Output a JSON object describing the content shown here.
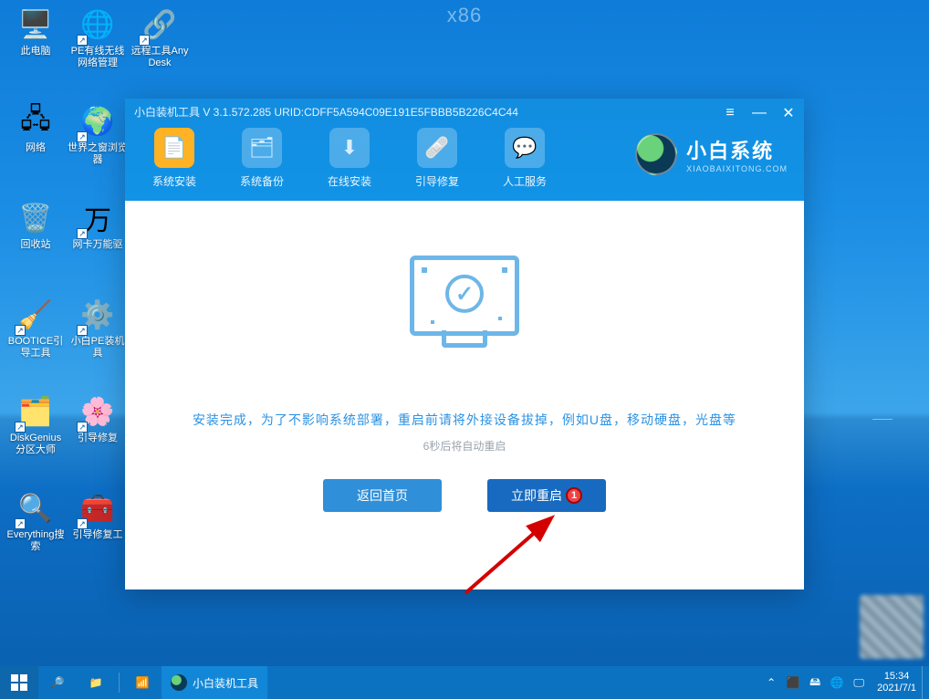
{
  "x86_label": "x86",
  "desktop_icons": [
    {
      "id": "this-pc",
      "label": "此电脑",
      "glyph": "🖥️",
      "shortcut": false
    },
    {
      "id": "pe-net",
      "label": "PE有线无线网络管理",
      "glyph": "🌐",
      "shortcut": true
    },
    {
      "id": "anydesk",
      "label": "远程工具AnyDesk",
      "glyph": "🔗",
      "shortcut": true
    },
    {
      "id": "network",
      "label": "网络",
      "glyph": "🖧",
      "shortcut": false
    },
    {
      "id": "world-browser",
      "label": "世界之窗浏览器",
      "glyph": "🌍",
      "shortcut": true
    },
    {
      "id": "blank1",
      "label": "",
      "glyph": "",
      "shortcut": false
    },
    {
      "id": "recycle",
      "label": "回收站",
      "glyph": "🗑️",
      "shortcut": false
    },
    {
      "id": "wanka",
      "label": "网卡万能驱",
      "glyph": "万",
      "shortcut": true
    },
    {
      "id": "blank2",
      "label": "",
      "glyph": "",
      "shortcut": false
    },
    {
      "id": "bootice",
      "label": "BOOTICE引导工具",
      "glyph": "🧹",
      "shortcut": true
    },
    {
      "id": "xiaobai-pe",
      "label": "小白PE装机具",
      "glyph": "⚙️",
      "shortcut": true
    },
    {
      "id": "blank3",
      "label": "",
      "glyph": "",
      "shortcut": false
    },
    {
      "id": "diskgenius",
      "label": "DiskGenius分区大师",
      "glyph": "🗂️",
      "shortcut": true
    },
    {
      "id": "boot-repair",
      "label": "引导修复",
      "glyph": "🌸",
      "shortcut": true
    },
    {
      "id": "blank4",
      "label": "",
      "glyph": "",
      "shortcut": false
    },
    {
      "id": "everything",
      "label": "Everything搜索",
      "glyph": "🔍",
      "shortcut": true
    },
    {
      "id": "boot-repair2",
      "label": "引导修复工",
      "glyph": "🧰",
      "shortcut": true
    }
  ],
  "app": {
    "title": "小白装机工具 V 3.1.572.285 URID:CDFF5A594C09E191E5FBBB5B226C4C44",
    "brand_cn": "小白系统",
    "brand_en": "XIAOBAIXITONG.COM",
    "toolbar": [
      {
        "id": "install",
        "label": "系统安装",
        "glyph": "📄",
        "active": true
      },
      {
        "id": "backup",
        "label": "系统备份",
        "glyph": "🗂",
        "active": false
      },
      {
        "id": "online",
        "label": "在线安装",
        "glyph": "⬇",
        "active": false
      },
      {
        "id": "bootfix",
        "label": "引导修复",
        "glyph": "🩹",
        "active": false
      },
      {
        "id": "service",
        "label": "人工服务",
        "glyph": "💬",
        "active": false
      }
    ],
    "msg_primary": "安装完成，为了不影响系统部署，重启前请将外接设备拔掉，例如U盘，移动硬盘，光盘等",
    "msg_secondary": "6秒后将自动重启",
    "btn_back": "返回首页",
    "btn_restart": "立即重启",
    "badge": "1"
  },
  "taskbar": {
    "active_title": "小白装机工具",
    "time": "15:34",
    "date": "2021/7/1"
  }
}
